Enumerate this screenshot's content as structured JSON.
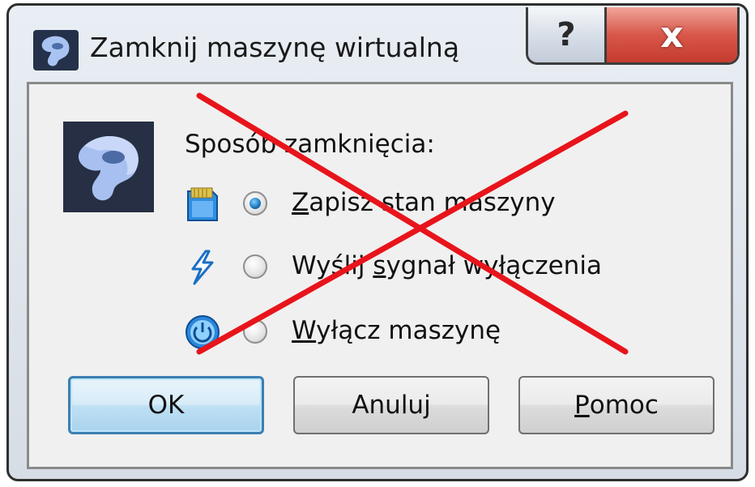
{
  "window": {
    "title": "Zamknij maszynę wirtualną",
    "help_button": "?",
    "close_button": "x"
  },
  "dialog": {
    "group_label": "Sposób zamknięcia:",
    "options": [
      {
        "label_prefix": "",
        "mnemonic": "Z",
        "label_rest": "apisz stan maszyny",
        "checked": true,
        "icon": "sd-card-icon"
      },
      {
        "label_prefix": "Wyślij ",
        "mnemonic": "s",
        "label_rest": "ygnał wyłączenia",
        "checked": false,
        "icon": "lightning-icon"
      },
      {
        "label_prefix": "",
        "mnemonic": "W",
        "label_rest": "yłącz maszynę",
        "checked": false,
        "icon": "power-icon"
      }
    ],
    "buttons": {
      "ok": "OK",
      "cancel": "Anuluj",
      "help_mnemonic": "P",
      "help_rest": "omoc"
    }
  },
  "overlay": {
    "color": "#e8141b"
  }
}
